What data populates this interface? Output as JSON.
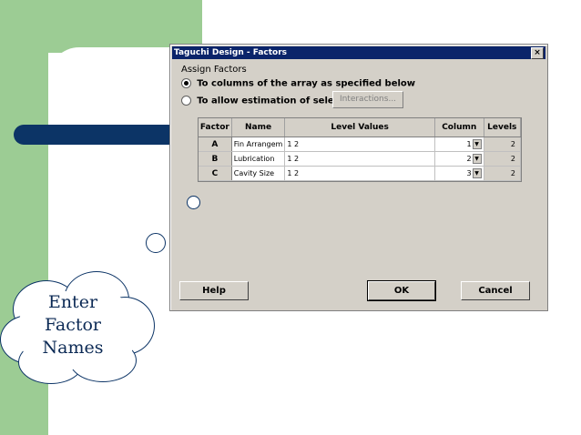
{
  "dialog": {
    "title": "Taguchi Design - Factors",
    "close_label": "×",
    "section_label": "Assign Factors",
    "radio_columns_label": "To columns of the array as specified below",
    "radio_estimation_label": "To allow estimation of selected",
    "interactions_button": "Interactions...",
    "help_button": "Help",
    "ok_button": "OK",
    "cancel_button": "Cancel"
  },
  "table": {
    "headers": [
      "Factor",
      "Name",
      "Level Values",
      "Column",
      "Levels"
    ],
    "rows": [
      {
        "factor": "A",
        "name": "Fin Arrangem",
        "level_values": "1 2",
        "column": "1",
        "levels": "2"
      },
      {
        "factor": "B",
        "name": "Lubrication",
        "level_values": "1 2",
        "column": "2",
        "levels": "2"
      },
      {
        "factor": "C",
        "name": "Cavity Size",
        "level_values": "1 2",
        "column": "3",
        "levels": "2"
      }
    ]
  },
  "callout": {
    "line1": "Enter",
    "line2": "Factor",
    "line3": "Names"
  },
  "colors": {
    "green": "#9ccc94",
    "navy": "#0c3466",
    "dialog_bg": "#d4d0c8",
    "titlebar": "#0a246a"
  }
}
